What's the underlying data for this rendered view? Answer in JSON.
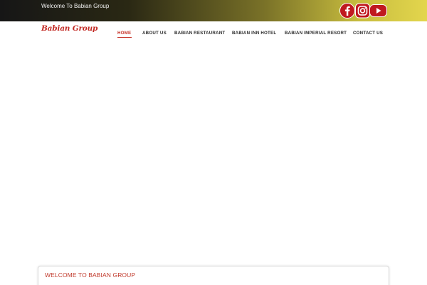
{
  "topbar": {
    "welcome_text": "Welcome To Babian Group",
    "social": [
      {
        "name": "facebook",
        "icon": "facebook-icon",
        "color": "#c0191f"
      },
      {
        "name": "instagram",
        "icon": "instagram-icon",
        "color": "#c0191f"
      },
      {
        "name": "youtube",
        "icon": "youtube-icon",
        "color": "#c0191f"
      }
    ]
  },
  "navbar": {
    "logo_text": "Babian Group",
    "items": [
      {
        "label": "HOME",
        "active": true
      },
      {
        "label": "ABOUT US"
      },
      {
        "label": "BABIAN RESTAURANT"
      },
      {
        "label": "BABIAN INN HOTEL"
      },
      {
        "label": "BABIAN IMPERIAL RESORT"
      },
      {
        "label": "CONTACT US"
      }
    ]
  },
  "section": {
    "title": "WELCOME TO BABIAN GROUP"
  },
  "colors": {
    "accent": "#c8362c",
    "topbar_start": "#161616",
    "topbar_end": "#e3d64d"
  }
}
